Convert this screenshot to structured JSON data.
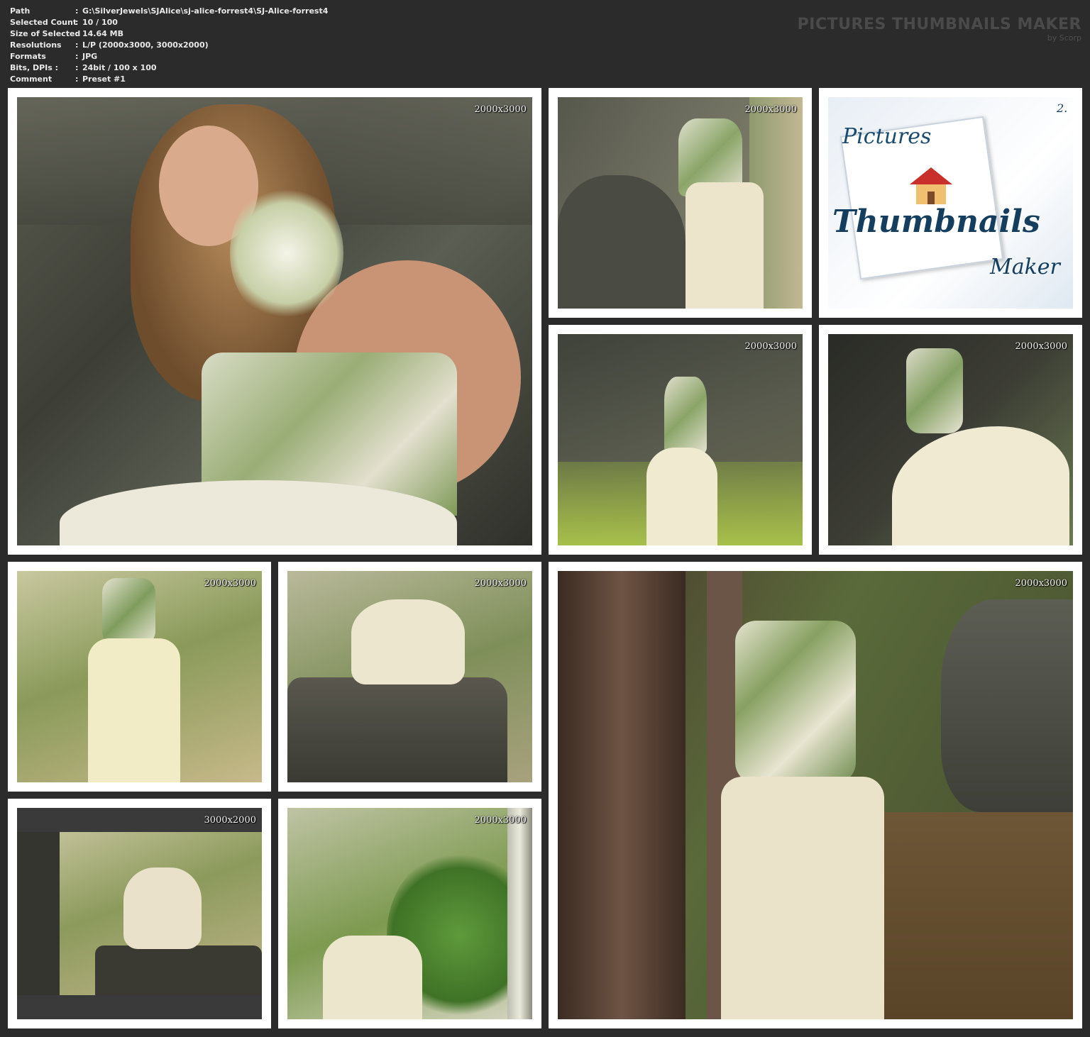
{
  "info": {
    "rows": [
      {
        "key": "Path",
        "sep": ":",
        "value": "G:\\SilverJewels\\SJAlice\\sj-alice-forrest4\\SJ-Alice-forrest4"
      },
      {
        "key": "Selected Count",
        "sep": ":",
        "value": "10 / 100"
      },
      {
        "key": "Size of Selected",
        "sep": ":",
        "value": "14.64 MB"
      },
      {
        "key": "Resolutions",
        "sep": ":",
        "value": "L/P (2000x3000, 3000x2000)"
      },
      {
        "key": "Formats",
        "sep": ":",
        "value": "JPG"
      },
      {
        "key": "Bits, DPIs :",
        "sep": ":",
        "value": "24bit / 100 x 100"
      },
      {
        "key": "Comment",
        "sep": ":",
        "value": "Preset #1"
      }
    ]
  },
  "brand": {
    "title": "PICTURES THUMBNAILS MAKER",
    "subtitle": "by Scorp"
  },
  "logo": {
    "word1": "Pictures",
    "word2": "Thumbnails",
    "word3": "Maker",
    "corner": "2."
  },
  "thumbnails": [
    {
      "resolution": "2000x3000"
    },
    {
      "resolution": "2000x3000"
    },
    {
      "resolution": ""
    },
    {
      "resolution": "2000x3000"
    },
    {
      "resolution": "2000x3000"
    },
    {
      "resolution": "2000x3000"
    },
    {
      "resolution": "2000x3000"
    },
    {
      "resolution": "2000x3000"
    },
    {
      "resolution": "3000x2000"
    },
    {
      "resolution": "2000x3000"
    }
  ],
  "colors": {
    "background": "#2b2b2b",
    "tile": "#ffffff",
    "forest_dark": "#3e4236",
    "forest_green": "#6f7d4b",
    "dress": "#e9e3c8",
    "rock": "#4d4c44"
  }
}
